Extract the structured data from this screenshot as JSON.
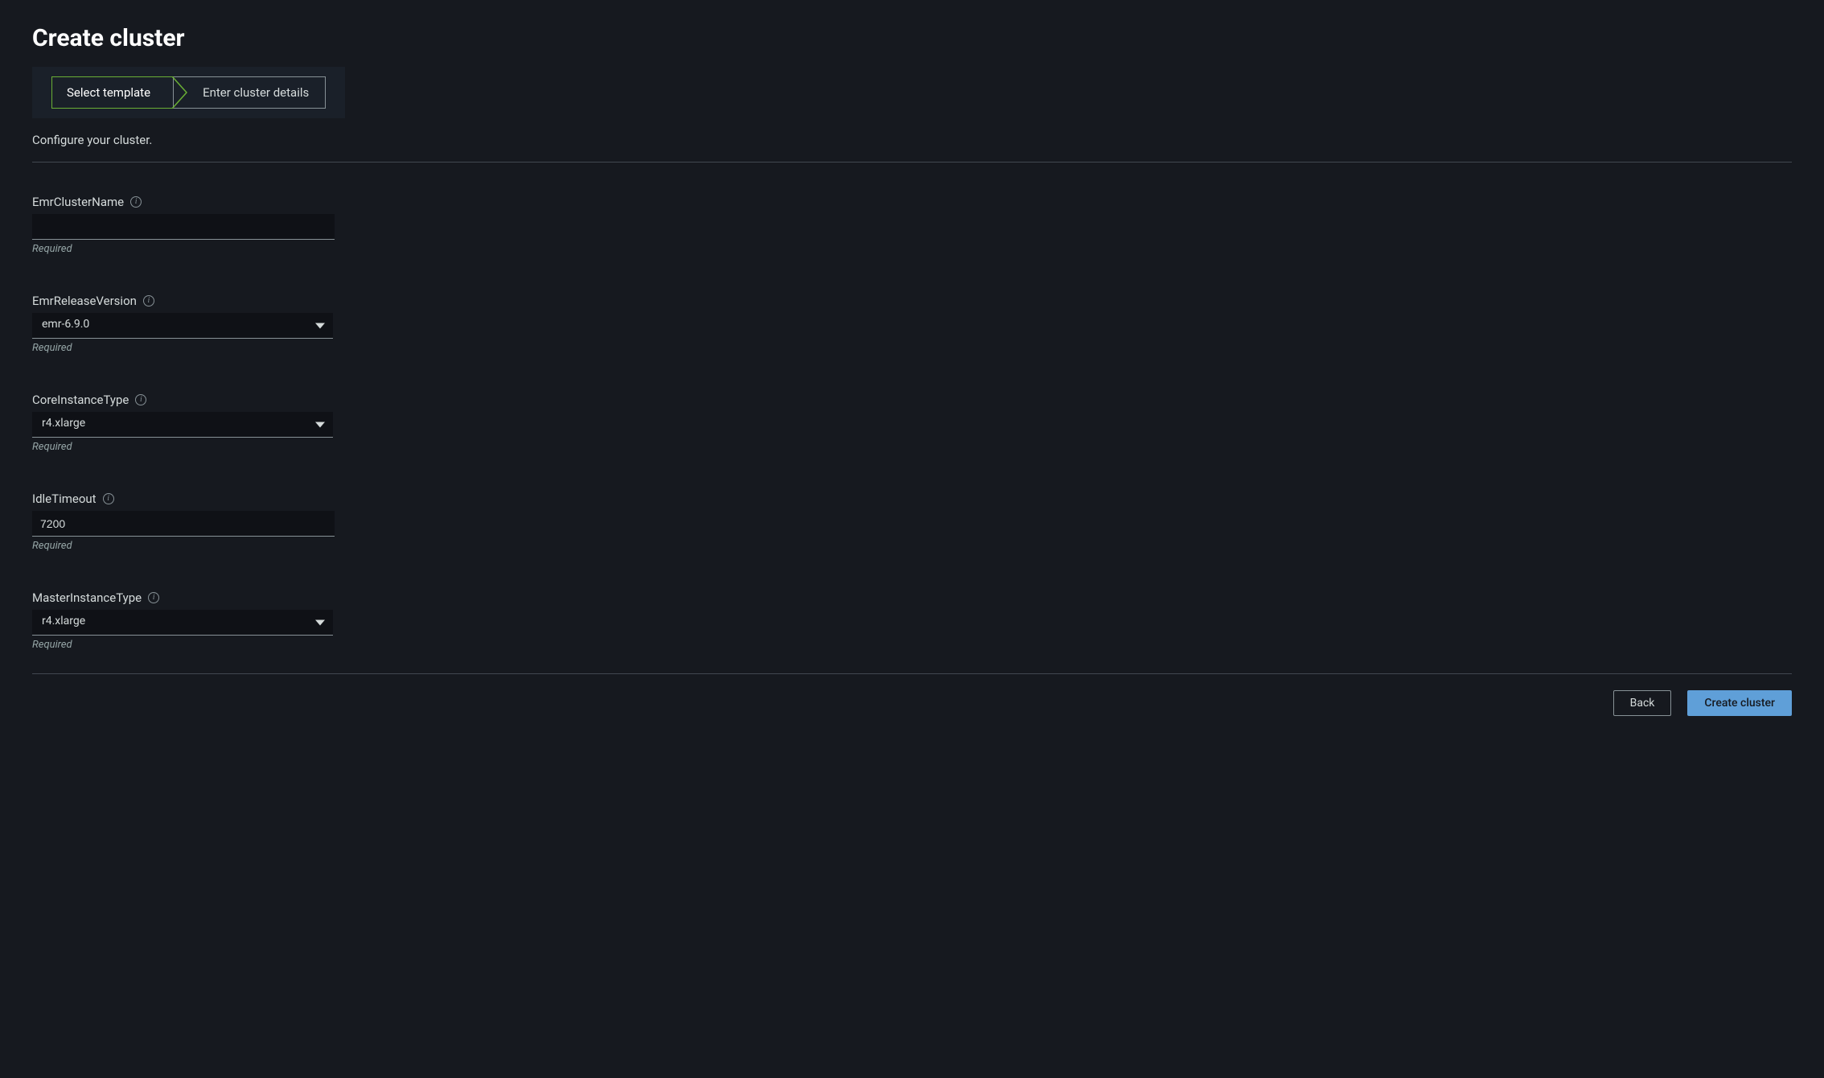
{
  "page": {
    "title": "Create cluster",
    "subtitle": "Configure your cluster."
  },
  "wizard": {
    "step1": "Select template",
    "step2": "Enter cluster details"
  },
  "form": {
    "emrClusterName": {
      "label": "EmrClusterName",
      "value": "",
      "helper": "Required"
    },
    "emrReleaseVersion": {
      "label": "EmrReleaseVersion",
      "value": "emr-6.9.0",
      "helper": "Required"
    },
    "coreInstanceType": {
      "label": "CoreInstanceType",
      "value": "r4.xlarge",
      "helper": "Required"
    },
    "idleTimeout": {
      "label": "IdleTimeout",
      "value": "7200",
      "helper": "Required"
    },
    "masterInstanceType": {
      "label": "MasterInstanceType",
      "value": "r4.xlarge",
      "helper": "Required"
    }
  },
  "footer": {
    "back": "Back",
    "create": "Create cluster"
  }
}
